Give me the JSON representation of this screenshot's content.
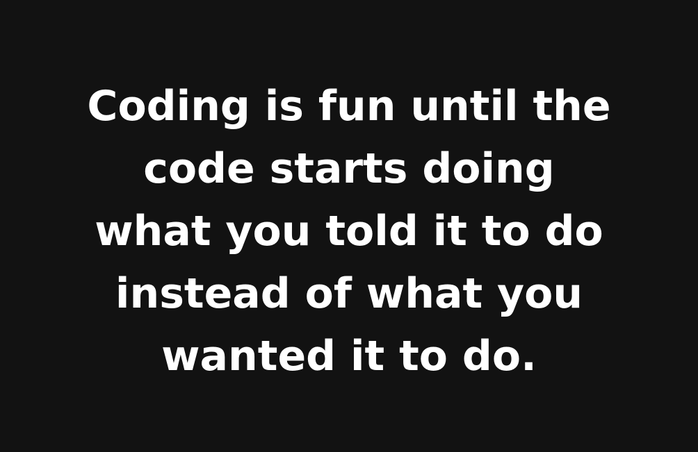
{
  "colors": {
    "background": "#121212",
    "text": "#ffffff"
  },
  "quote": {
    "lines": [
      "Coding is fun until the",
      "code starts doing",
      "what you told it to do",
      "instead of what you",
      "wanted it to do."
    ]
  }
}
